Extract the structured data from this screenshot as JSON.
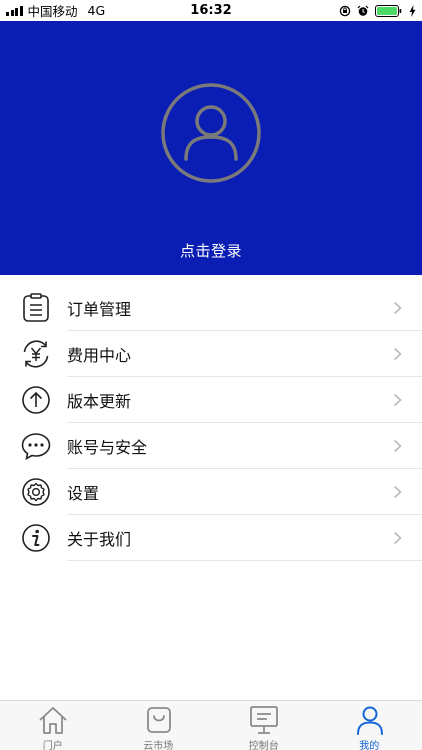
{
  "status_bar": {
    "carrier": "中国移动",
    "network": "4G",
    "time": "16:32"
  },
  "profile": {
    "login_text": "点击登录",
    "avatar_icon": "user-avatar-icon"
  },
  "menu": {
    "items": [
      {
        "label": "订单管理",
        "icon": "clipboard-icon"
      },
      {
        "label": "费用中心",
        "icon": "yuan-refresh-icon"
      },
      {
        "label": "版本更新",
        "icon": "arrow-up-circle-icon"
      },
      {
        "label": "账号与安全",
        "icon": "chat-bubble-icon"
      },
      {
        "label": "设置",
        "icon": "gear-icon"
      },
      {
        "label": "关于我们",
        "icon": "info-icon"
      }
    ]
  },
  "tab_bar": {
    "tabs": [
      {
        "label": "门户",
        "icon": "home-icon"
      },
      {
        "label": "云市场",
        "icon": "shopping-bag-icon"
      },
      {
        "label": "控制台",
        "icon": "monitor-icon"
      },
      {
        "label": "我的",
        "icon": "user-icon",
        "active": true
      }
    ]
  },
  "colors": {
    "hero_background": "#0a1eb4",
    "active_tab": "#1466d8",
    "inactive_tab": "#777777"
  }
}
